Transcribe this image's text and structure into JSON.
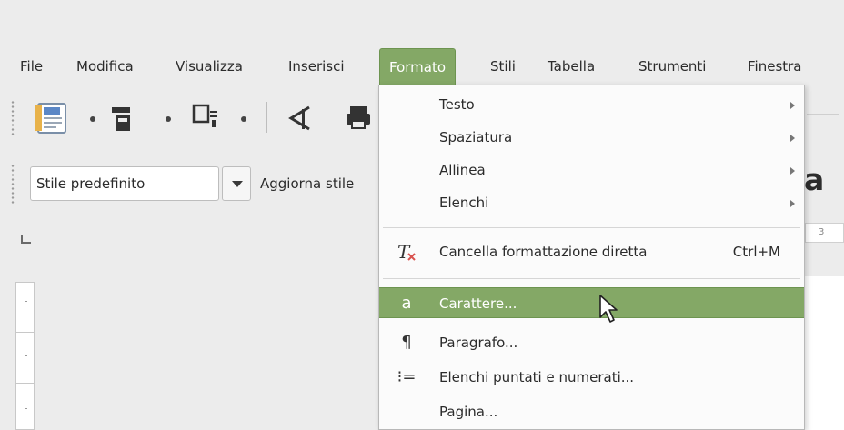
{
  "menubar": {
    "items": [
      {
        "label": "File"
      },
      {
        "label": "Modifica"
      },
      {
        "label": "Visualizza"
      },
      {
        "label": "Inserisci"
      },
      {
        "label": "Formato"
      },
      {
        "label": "Stili"
      },
      {
        "label": "Tabella"
      },
      {
        "label": "Strumenti"
      },
      {
        "label": "Finestra"
      }
    ],
    "active": "Formato"
  },
  "toolbar": {
    "icons": [
      "document-icon",
      "page-icon",
      "insert-icon",
      "arrow-icon",
      "print-icon"
    ]
  },
  "styles_bar": {
    "style_value": "Stile predefinito",
    "update_label": "Aggiorna stile",
    "big_letter": "a"
  },
  "ruler": {
    "visible_tick": "3"
  },
  "format_menu": {
    "items": [
      {
        "label": "Testo",
        "submenu": true
      },
      {
        "label": "Spaziatura",
        "submenu": true
      },
      {
        "label": "Allinea",
        "submenu": true
      },
      {
        "label": "Elenchi",
        "submenu": true
      },
      {
        "label": "Cancella formattazione diretta",
        "shortcut": "Ctrl+M",
        "icon": "clear-formatting-icon"
      },
      {
        "label": "Carattere...",
        "icon": "character-icon",
        "icon_glyph": "a",
        "highlighted": true
      },
      {
        "label": "Paragrafo...",
        "icon": "paragraph-icon",
        "icon_glyph": "¶"
      },
      {
        "label": "Elenchi puntati e numerati...",
        "icon": "numbered-list-icon",
        "icon_glyph": "⁝="
      },
      {
        "label": "Pagina..."
      }
    ]
  },
  "colors": {
    "accent": "#84a866",
    "menu_bg": "#fbfbfb",
    "window_bg": "#ececec"
  }
}
